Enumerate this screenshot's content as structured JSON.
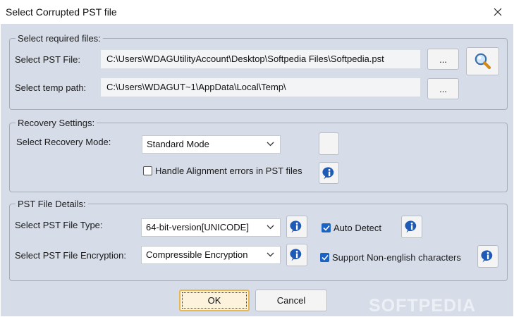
{
  "window": {
    "title": "Select Corrupted PST file"
  },
  "files_group": {
    "legend": "Select required files:",
    "pst_label": "Select PST File:",
    "pst_value": "C:\\Users\\WDAGUtilityAccount\\Desktop\\Softpedia Files\\Softpedia.pst",
    "pst_browse": "...",
    "temp_label": "Select temp path:",
    "temp_value": "C:\\Users\\WDAGUT~1\\AppData\\Local\\Temp\\",
    "temp_browse": "..."
  },
  "recovery_group": {
    "legend": "Recovery Settings:",
    "mode_label": "Select Recovery Mode:",
    "mode_value": "Standard Mode",
    "alignment_label": "Handle Alignment errors in PST files",
    "alignment_checked": false
  },
  "details_group": {
    "legend": "PST File Details:",
    "type_label": "Select PST File Type:",
    "type_value": "64-bit-version[UNICODE]",
    "auto_detect_label": "Auto Detect",
    "auto_detect_checked": true,
    "encryption_label": "Select PST File Encryption:",
    "encryption_value": "Compressible Encryption",
    "non_english_label": "Support Non-english characters",
    "non_english_checked": true
  },
  "buttons": {
    "ok": "OK",
    "cancel": "Cancel"
  },
  "watermark": "SOFTPEDIA",
  "icons": {
    "close": "close-icon",
    "search": "search-icon",
    "info": "info-icon",
    "chevron": "chevron-down-icon",
    "check": "checkmark-icon"
  },
  "colors": {
    "dialog_bg": "#d6dde9",
    "group_border": "#a4acb8",
    "ok_accent": "#f0c060",
    "info_blue": "#1e5ab6",
    "check_blue": "#1a63c4"
  }
}
